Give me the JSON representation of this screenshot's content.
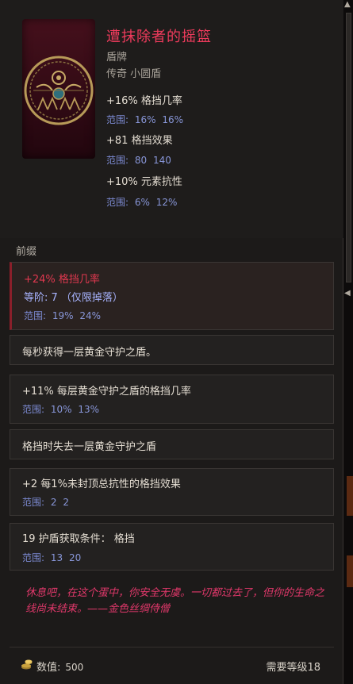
{
  "item": {
    "name": "遭抹除者的摇篮",
    "category": "盾牌",
    "rarity_type": "传奇 小圆盾",
    "name_color": "#ef3b5c",
    "implicits": [
      {
        "text": "+16% 格挡几率",
        "range_label": "范围:",
        "range_min": "16%",
        "range_max": "16%"
      },
      {
        "text": "+81 格挡效果",
        "range_label": "范围:",
        "range_min": "80",
        "range_max": "140"
      },
      {
        "text": "+10% 元素抗性",
        "range_label": "范围:",
        "range_min": "6%",
        "range_max": "12%"
      }
    ]
  },
  "affix_section": {
    "label": "前缀",
    "affixes": [
      {
        "text": "+24% 格挡几率",
        "tier": "等阶: 7 （仅限掉落）",
        "range_label": "范围:",
        "range_min": "19%",
        "range_max": "24%"
      },
      {
        "text": "每秒获得一层黄金守护之盾。"
      },
      {
        "text": "+11% 每层黄金守护之盾的格挡几率",
        "range_label": "范围:",
        "range_min": "10%",
        "range_max": "13%"
      },
      {
        "text": "格挡时失去一层黄金守护之盾"
      },
      {
        "text": "+2 每1%未封顶总抗性的格挡效果",
        "range_label": "范围:",
        "range_min": "2",
        "range_max": "2"
      },
      {
        "text": "19 护盾获取条件： 格挡",
        "range_label": "范围:",
        "range_min": "13",
        "range_max": "20"
      }
    ]
  },
  "lore": "休息吧，在这个蛋中，你安全无虞。一切都过去了，但你的生命之线尚未结束。——金色丝绸侍僧",
  "footer": {
    "value_label": "数值:",
    "value": "500",
    "required_level": "需要等级18"
  },
  "icons": {
    "shield": "golden-shield-emblem-icon",
    "gold": "gold-coins-icon"
  }
}
